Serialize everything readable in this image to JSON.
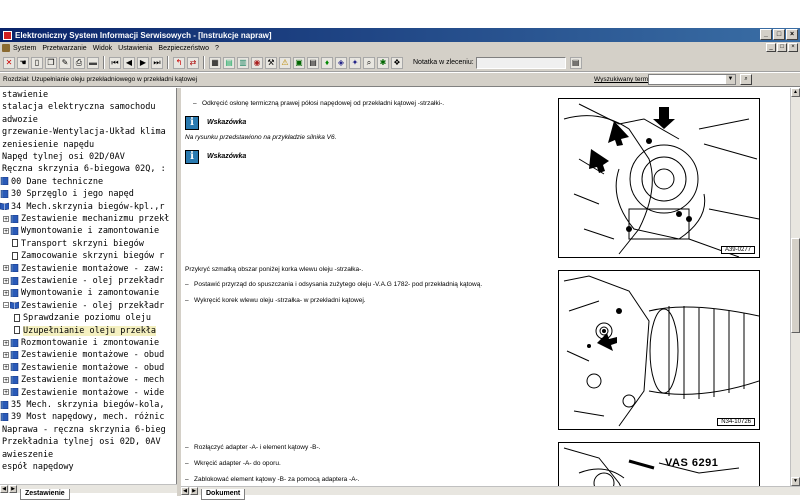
{
  "window": {
    "title": "Elektroniczny System Informacji Serwisowych - [Instrukcje napraw]",
    "controls": [
      "_",
      "□",
      "×"
    ]
  },
  "menu": {
    "items": [
      "System",
      "Przetwarzanie",
      "Widok",
      "Ustawienia",
      "Bezpieczeństwo",
      "?"
    ],
    "mdi_controls": [
      "_",
      "□",
      "×"
    ]
  },
  "toolbar": {
    "notatka_label": "Notatka w zleceniu:",
    "notatka_value": ""
  },
  "infobar": {
    "breadcrumb": "Rozdział: Uzupełnianie oleju przekładniowego w przekładni kątowej",
    "search_label": "Wyszukiwany termin",
    "search_value": ""
  },
  "tree": {
    "items": [
      {
        "text": "stawienie",
        "indent": 0,
        "icon": "none"
      },
      {
        "text": "stalacja elektryczna samochodu",
        "indent": 0,
        "icon": "none"
      },
      {
        "text": "adwozie",
        "indent": 0,
        "icon": "none"
      },
      {
        "text": "grzewanie-Wentylacja-Układ klima",
        "indent": 0,
        "icon": "none"
      },
      {
        "text": "zeniesienie napędu",
        "indent": 0,
        "icon": "none"
      },
      {
        "text": "Napęd tylnej osi 02D/0AV",
        "indent": 0,
        "icon": "none"
      },
      {
        "text": "Ręczna skrzynia 6-biegowa 02Q, :",
        "indent": 0,
        "icon": "none"
      },
      {
        "text": "00 Dane techniczne",
        "indent": 1,
        "icon": "book"
      },
      {
        "text": "30 Sprzęglo i jego napęd",
        "indent": 1,
        "icon": "book"
      },
      {
        "text": "34 Mech.skrzynia biegów-kpl.,r",
        "indent": 1,
        "icon": "book-open"
      },
      {
        "text": "Zestawienie mechanizmu przekł",
        "indent": 2,
        "icon": "book"
      },
      {
        "text": "Wymontowanie i zamontowanie",
        "indent": 2,
        "icon": "book"
      },
      {
        "text": "Transport skrzyni biegów",
        "indent": 2,
        "icon": "doc"
      },
      {
        "text": "Zamocowanie skrzyni biegów r",
        "indent": 2,
        "icon": "doc"
      },
      {
        "text": "Zestawienie montażowe - zaw:",
        "indent": 2,
        "icon": "book"
      },
      {
        "text": "Zestawienie - olej przekładr",
        "indent": 2,
        "icon": "book"
      },
      {
        "text": "Wymontowanie i zamontowanie",
        "indent": 2,
        "icon": "book"
      },
      {
        "text": "Zestawienie - olej przekładr",
        "indent": 2,
        "icon": "book-open"
      },
      {
        "text": "Sprawdzanie poziomu oleju",
        "indent": 3,
        "icon": "doc"
      },
      {
        "text": "Uzupełnianie oleju przekła",
        "indent": 3,
        "icon": "doc",
        "selected": true
      },
      {
        "text": "Rozmontowanie i zmontowanie",
        "indent": 2,
        "icon": "book"
      },
      {
        "text": "Zestawienie montażowe - obud",
        "indent": 2,
        "icon": "book"
      },
      {
        "text": "Zestawienie montażowe - obud",
        "indent": 2,
        "icon": "book"
      },
      {
        "text": "Zestawienie montażowe - mech",
        "indent": 2,
        "icon": "book"
      },
      {
        "text": "Zestawienie montażowe - wide",
        "indent": 2,
        "icon": "book"
      },
      {
        "text": "35 Mech. skrzynia biegów-kola,",
        "indent": 1,
        "icon": "book"
      },
      {
        "text": "39 Most napędowy, mech. różnic",
        "indent": 1,
        "icon": "book"
      },
      {
        "text": "Naprawa - ręczna skrzynia 6-bieg",
        "indent": 0,
        "icon": "none"
      },
      {
        "text": "Przekładnia tylnej osi 02D, 0AV",
        "indent": 0,
        "icon": "none"
      },
      {
        "text": "awieszenie",
        "indent": 0,
        "icon": "none"
      },
      {
        "text": "espół napędowy",
        "indent": 0,
        "icon": "none"
      }
    ],
    "tab_label": "Zestawienie"
  },
  "content": {
    "step1": "Odkręcić osłonę termiczną prawej półosi napędowej od przekładni kątowej -strzałki-.",
    "note1_title": "Wskazówka",
    "note1_text": "Na rysunku przedstawiono na przykładzie silnika V6.",
    "note2_title": "Wskazówka",
    "step2": "Przykryć szmatką obszar poniżej korka wlewu oleju -strzałka-.",
    "step3": "Postawić przyrząd do spuszczania i odsysania zużytego oleju -V.A.G 1782- pod przekładnią kątową.",
    "step4": "Wykręcić korek wlewu oleju -strzałka- w przekładni kątowej.",
    "step5": "Rozłączyć adapter -A- i element kątowy -B-.",
    "step6": "Wkręcić adapter -A- do oporu.",
    "step7": "Zablokować element kątowy -B- za pomocą adaptera -A-.",
    "figure1_id": "A39-0277",
    "figure2_id": "N34-10726",
    "figure3_label": "VAS 6291",
    "tab_label": "Dokument"
  }
}
